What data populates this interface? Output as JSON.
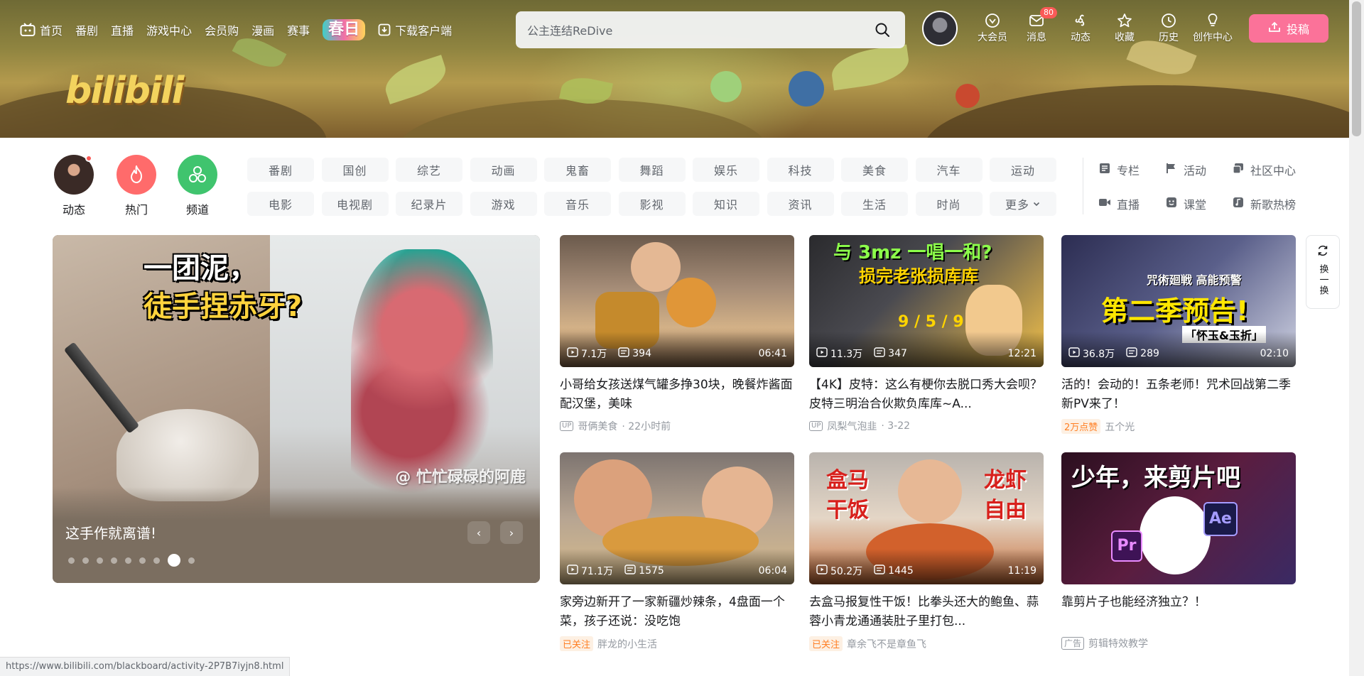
{
  "topnav": {
    "items": [
      {
        "label": "首页",
        "icon": "tv-icon"
      },
      {
        "label": "番剧"
      },
      {
        "label": "直播"
      },
      {
        "label": "游戏中心"
      },
      {
        "label": "会员购"
      },
      {
        "label": "漫画"
      },
      {
        "label": "赛事"
      }
    ],
    "spring_badge": "春日",
    "download_label": "下载客户端"
  },
  "search": {
    "placeholder": "公主连结ReDive"
  },
  "right_nav": [
    {
      "label": "大会员",
      "icon": "vip-icon"
    },
    {
      "label": "消息",
      "icon": "message-icon",
      "badge": "80"
    },
    {
      "label": "动态",
      "icon": "dynamic-icon"
    },
    {
      "label": "收藏",
      "icon": "star-icon"
    },
    {
      "label": "历史",
      "icon": "history-icon"
    },
    {
      "label": "创作中心",
      "icon": "bulb-icon"
    }
  ],
  "upload_label": "投稿",
  "logo_text": "bilibili",
  "quick": [
    {
      "label": "动态"
    },
    {
      "label": "热门"
    },
    {
      "label": "频道"
    }
  ],
  "categories": [
    "番剧",
    "国创",
    "综艺",
    "动画",
    "鬼畜",
    "舞蹈",
    "娱乐",
    "科技",
    "美食",
    "汽车",
    "运动",
    "电影",
    "电视剧",
    "纪录片",
    "游戏",
    "音乐",
    "影视",
    "知识",
    "资讯",
    "生活",
    "时尚",
    "更多"
  ],
  "side_links": [
    {
      "label": "专栏",
      "icon": "article-icon"
    },
    {
      "label": "活动",
      "icon": "flag-icon"
    },
    {
      "label": "社区中心",
      "icon": "community-icon"
    },
    {
      "label": "直播",
      "icon": "live-icon"
    },
    {
      "label": "课堂",
      "icon": "class-icon"
    },
    {
      "label": "新歌热榜",
      "icon": "music-icon"
    }
  ],
  "carousel": {
    "headline_1": "一团泥，",
    "headline_2": "徒手捏赤牙?",
    "credit": "@ 忙忙碌碌的阿鹿",
    "caption": "这手作就离谱!",
    "dot_count": 9,
    "active_dot": 8
  },
  "videos": [
    {
      "title": "小哥给女孩送煤气罐多挣30块，晚餐炸酱面配汉堡，美味",
      "views": "7.1万",
      "danmaku": "394",
      "duration": "06:41",
      "up_tag": "UP",
      "author": "哥俩美食",
      "time": "· 22小时前"
    },
    {
      "title": "【4K】皮特：这么有梗你去脱口秀大会呗？皮特三明治合伙欺负库库~A...",
      "views": "11.3万",
      "danmaku": "347",
      "duration": "12:21",
      "up_tag": "UP",
      "author": "凤梨气泡韭",
      "time": "· 3-22",
      "overlay_1": "与 3mz 一唱一和?",
      "overlay_2": "损完老张损库库",
      "overlay_3": "9 / 5 / 9"
    },
    {
      "title": "活的！会动的！五条老师！咒术回战第二季新PV来了！",
      "views": "36.8万",
      "danmaku": "289",
      "duration": "02:10",
      "tag": "2万点赞",
      "author": "五个光",
      "overlay_1": "咒術廻戦 高能预警",
      "overlay_2": "第二季预告!",
      "overlay_3": "「怀玉&玉折」"
    },
    {
      "title": "家旁边新开了一家新疆炒辣条，4盘面一个菜，孩子还说：没吃饱",
      "views": "71.1万",
      "danmaku": "1575",
      "duration": "06:04",
      "tag": "已关注",
      "author": "胖龙的小生活"
    },
    {
      "title": "去盒马报复性干饭！比拳头还大的鲍鱼、蒜蓉小青龙通通装肚子里打包...",
      "views": "50.2万",
      "danmaku": "1445",
      "duration": "11:19",
      "tag": "已关注",
      "author": "章余飞不是章鱼飞",
      "overlay_1": "盒马",
      "overlay_2": "干饭",
      "overlay_3": "龙虾",
      "overlay_4": "自由"
    },
    {
      "title": "靠剪片子也能经济独立？！",
      "tag_ad": "广告",
      "author": "剪辑特效教学",
      "overlay_1": "少年，来剪片吧",
      "overlay_2": "Pr",
      "overlay_3": "Ae"
    }
  ],
  "refresh": {
    "label": "换一换"
  },
  "status_url": "https://www.bilibili.com/blackboard/activity-2P7B7iyjn8.html",
  "colors": {
    "brand_pink": "#fb7299",
    "hot_red": "#ff6b6b",
    "channel_green": "#40c46e",
    "tag_orange": "#ff7f24"
  }
}
